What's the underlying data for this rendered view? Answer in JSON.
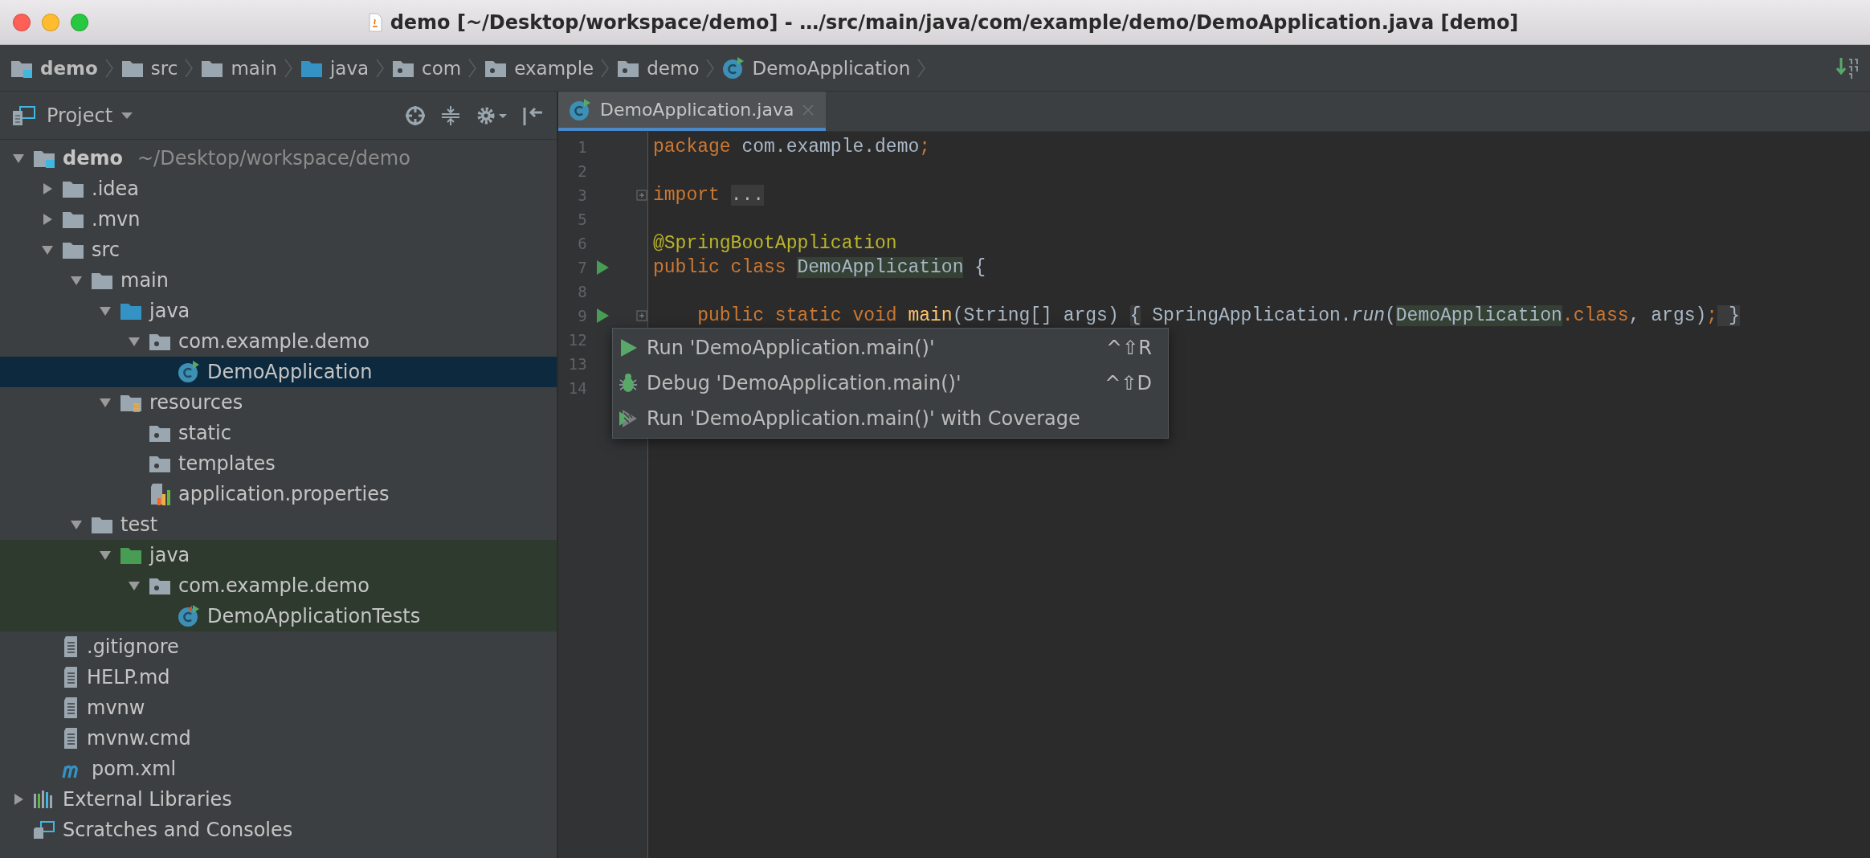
{
  "window": {
    "title": "demo [~/Desktop/workspace/demo] - …/src/main/java/com/example/demo/DemoApplication.java [demo]"
  },
  "breadcrumbs": [
    {
      "label": "demo",
      "kind": "module"
    },
    {
      "label": "src",
      "kind": "folder"
    },
    {
      "label": "main",
      "kind": "folder"
    },
    {
      "label": "java",
      "kind": "source_folder"
    },
    {
      "label": "com",
      "kind": "package"
    },
    {
      "label": "example",
      "kind": "package"
    },
    {
      "label": "demo",
      "kind": "package"
    },
    {
      "label": "DemoApplication",
      "kind": "class"
    }
  ],
  "project_panel": {
    "title": "Project",
    "tree": [
      {
        "label": "demo",
        "path": "~/Desktop/workspace/demo",
        "kind": "module",
        "expanded": true,
        "selected": false,
        "children": [
          {
            "label": ".idea",
            "kind": "folder",
            "expanded": false,
            "selected": false
          },
          {
            "label": ".mvn",
            "kind": "folder",
            "expanded": false,
            "selected": false
          },
          {
            "label": "src",
            "kind": "folder",
            "expanded": true,
            "selected": false,
            "children": [
              {
                "label": "main",
                "kind": "folder",
                "expanded": true,
                "selected": false,
                "children": [
                  {
                    "label": "java",
                    "kind": "source_folder",
                    "expanded": true,
                    "selected": false,
                    "children": [
                      {
                        "label": "com.example.demo",
                        "kind": "package",
                        "expanded": true,
                        "selected": false,
                        "children": [
                          {
                            "label": "DemoApplication",
                            "kind": "class",
                            "selected": true
                          }
                        ]
                      }
                    ]
                  },
                  {
                    "label": "resources",
                    "kind": "resources_folder",
                    "expanded": true,
                    "selected": false,
                    "children": [
                      {
                        "label": "static",
                        "kind": "package",
                        "selected": false
                      },
                      {
                        "label": "templates",
                        "kind": "package",
                        "selected": false
                      },
                      {
                        "label": "application.properties",
                        "kind": "properties",
                        "selected": false
                      }
                    ]
                  }
                ]
              },
              {
                "label": "test",
                "kind": "folder",
                "expanded": true,
                "selected": false,
                "children": [
                  {
                    "label": "java",
                    "kind": "test_folder",
                    "expanded": true,
                    "selected": false,
                    "children": [
                      {
                        "label": "com.example.demo",
                        "kind": "package",
                        "expanded": true,
                        "selected": false,
                        "children": [
                          {
                            "label": "DemoApplicationTests",
                            "kind": "test_class",
                            "selected": false
                          }
                        ]
                      }
                    ]
                  }
                ]
              }
            ]
          },
          {
            "label": ".gitignore",
            "kind": "file",
            "selected": false
          },
          {
            "label": "HELP.md",
            "kind": "file",
            "selected": false
          },
          {
            "label": "mvnw",
            "kind": "file",
            "selected": false
          },
          {
            "label": "mvnw.cmd",
            "kind": "file",
            "selected": false
          },
          {
            "label": "pom.xml",
            "kind": "maven",
            "selected": false
          }
        ]
      },
      {
        "label": "External Libraries",
        "kind": "libraries",
        "expanded": false,
        "selected": false
      },
      {
        "label": "Scratches and Consoles",
        "kind": "scratches",
        "selected": false
      }
    ]
  },
  "editor": {
    "tabs": [
      {
        "label": "DemoApplication.java",
        "selected": true
      }
    ],
    "lines": [
      {
        "number": "1",
        "run_marker": false,
        "fold_marker": false,
        "tokens": [
          {
            "text": "package ",
            "kind": "keyword"
          },
          {
            "text": "com.example.demo",
            "kind": "plain"
          },
          {
            "text": ";",
            "kind": "keyword"
          }
        ]
      },
      {
        "number": "2",
        "run_marker": false,
        "fold_marker": false
      },
      {
        "number": "3",
        "run_marker": false,
        "fold_marker": true,
        "tokens": [
          {
            "text": "import ",
            "kind": "keyword"
          },
          {
            "text": "...",
            "kind": "folded"
          }
        ]
      },
      {
        "number": "5",
        "run_marker": false,
        "fold_marker": false
      },
      {
        "number": "6",
        "run_marker": false,
        "fold_marker": false,
        "tokens": [
          {
            "text": "@SpringBootApplication",
            "kind": "annotation"
          }
        ]
      },
      {
        "number": "7",
        "run_marker": true,
        "fold_marker": false,
        "tokens": [
          {
            "text": "public class ",
            "kind": "keyword"
          },
          {
            "text": "DemoApplication",
            "kind": "identifier"
          },
          {
            "text": " {",
            "kind": "plain"
          }
        ]
      },
      {
        "number": "8",
        "run_marker": false,
        "fold_marker": false
      },
      {
        "number": "9",
        "run_marker": true,
        "fold_marker": true,
        "tokens": [
          {
            "text": "    public static void ",
            "kind": "keyword"
          },
          {
            "text": "main",
            "kind": "method"
          },
          {
            "text": "(String[] args) ",
            "kind": "plain"
          },
          {
            "text": "{",
            "kind": "folded"
          },
          {
            "text": " SpringApplication.",
            "kind": "plain"
          },
          {
            "text": "run",
            "kind": "static_call"
          },
          {
            "text": "(",
            "kind": "plain"
          },
          {
            "text": "DemoApplication",
            "kind": "identifier"
          },
          {
            "text": ".class",
            "kind": "keyword"
          },
          {
            "text": ", args)",
            "kind": "plain"
          },
          {
            "text": ";",
            "kind": "keyword"
          },
          {
            "text": " }",
            "kind": "folded"
          }
        ]
      },
      {
        "number": "12",
        "run_marker": false
      },
      {
        "number": "13",
        "run_marker": false
      },
      {
        "number": "14",
        "run_marker": false
      }
    ]
  },
  "context_menu": {
    "items": [
      {
        "kind": "run",
        "label": "Run 'DemoApplication.main()'",
        "shortcut": "^⇧R"
      },
      {
        "kind": "debug",
        "label": "Debug 'DemoApplication.main()'",
        "shortcut": "^⇧D"
      },
      {
        "kind": "coverage",
        "label": "Run 'DemoApplication.main()' with Coverage"
      }
    ]
  }
}
